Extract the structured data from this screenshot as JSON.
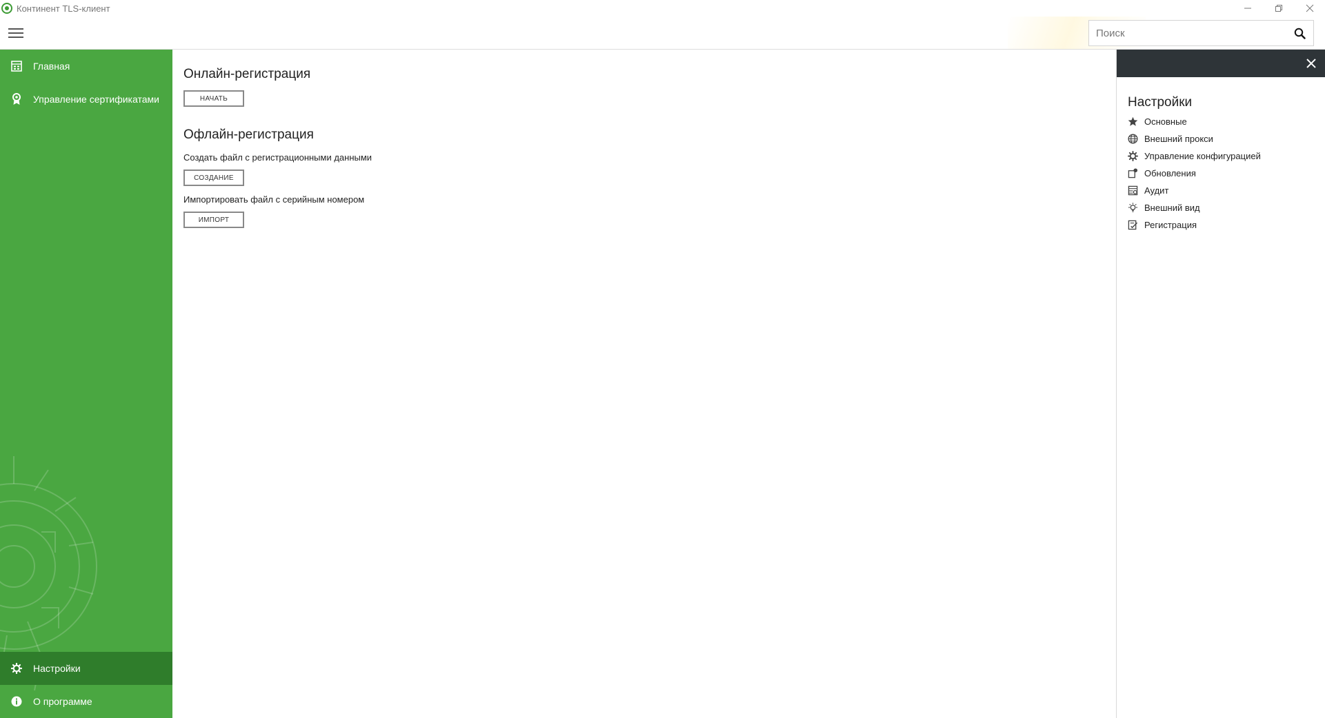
{
  "window": {
    "title": "Континент TLS-клиент",
    "controls": [
      "minimize-icon",
      "restore-icon",
      "close-icon"
    ]
  },
  "header": {
    "search_placeholder": "Поиск"
  },
  "sidebar": {
    "background": "#4aa741",
    "active_background": "#2f7d2b",
    "top_items": [
      {
        "label": "Главная",
        "icon": "dashboard-icon"
      },
      {
        "label": "Управление сертификатами",
        "icon": "certificate-icon"
      }
    ],
    "bottom_items": [
      {
        "label": "Настройки",
        "icon": "gear-icon",
        "active": true
      },
      {
        "label": "О программе",
        "icon": "info-icon"
      }
    ]
  },
  "main": {
    "online": {
      "title": "Онлайн-регистрация",
      "start_button": "НАЧАТЬ"
    },
    "offline": {
      "title": "Офлайн-регистрация",
      "create_desc": "Создать файл с регистрационными данными",
      "create_button": "СОЗДАНИЕ",
      "import_desc": "Импортировать файл с серийным номером",
      "import_button": "ИМПОРТ"
    }
  },
  "settings_panel": {
    "header_color": "#2e3438",
    "title": "Настройки",
    "items": [
      {
        "label": "Основные",
        "icon": "star-icon"
      },
      {
        "label": "Внешний прокси",
        "icon": "globe-icon"
      },
      {
        "label": "Управление конфигурацией",
        "icon": "gear-icon"
      },
      {
        "label": "Обновления",
        "icon": "update-icon"
      },
      {
        "label": "Аудит",
        "icon": "audit-icon"
      },
      {
        "label": "Внешний вид",
        "icon": "lightbulb-icon"
      },
      {
        "label": "Регистрация",
        "icon": "registration-icon"
      }
    ]
  }
}
